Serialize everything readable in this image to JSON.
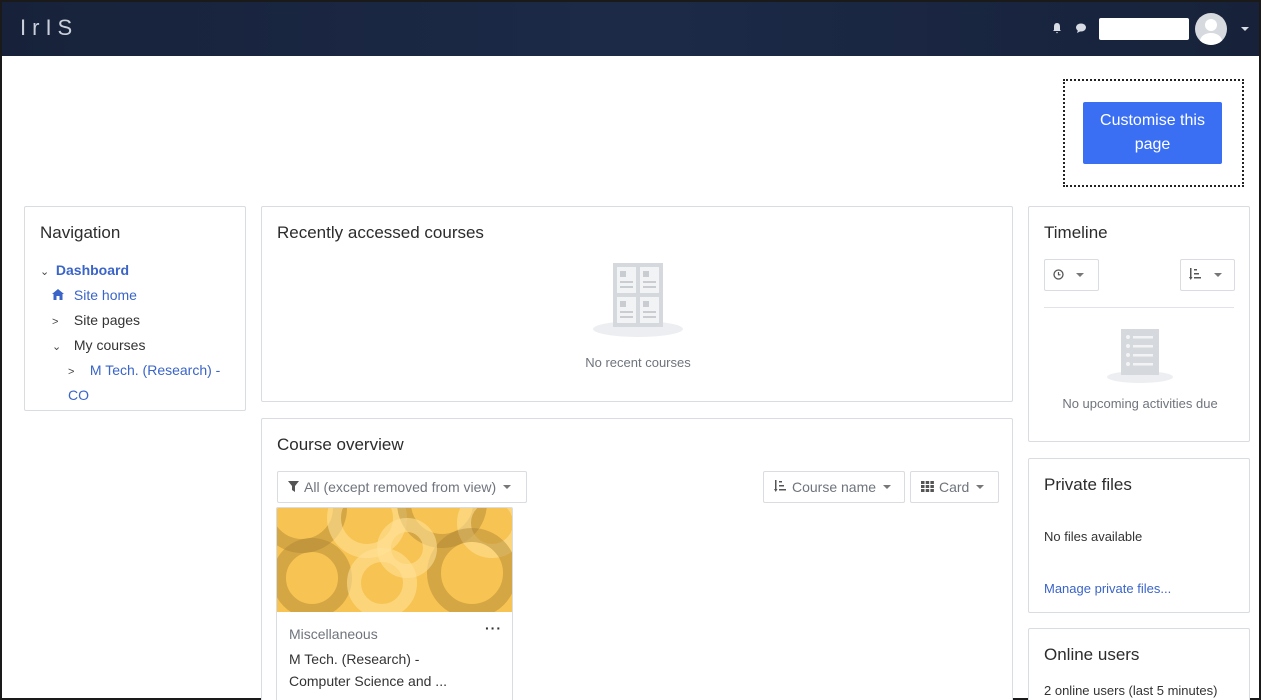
{
  "navbar": {
    "brand": "IrIS",
    "icons": [
      "bell-icon",
      "chat-icon",
      "avatar",
      "chevron-down-icon"
    ]
  },
  "customise_button": "Customise this page",
  "navigation": {
    "title": "Navigation",
    "items": [
      {
        "label": "Dashboard",
        "icon": "chevron-down-icon"
      },
      {
        "label": "Site home",
        "icon": "home-icon"
      },
      {
        "label": "Site pages",
        "icon": "chevron-right-icon"
      },
      {
        "label": "My courses",
        "icon": "chevron-down-icon"
      },
      {
        "label": "M Tech. (Research) -",
        "label2": "CO",
        "icon": "chevron-right-icon"
      }
    ]
  },
  "recent": {
    "title": "Recently accessed courses",
    "empty": "No recent courses"
  },
  "overview": {
    "title": "Course overview",
    "filter": "All (except removed from view)",
    "sort": "Course name",
    "view": "Card",
    "course": {
      "category": "Miscellaneous",
      "name_line1": "M Tech. (Research) -",
      "name_line2": "Computer Science and ..."
    }
  },
  "timeline": {
    "title": "Timeline",
    "empty": "No upcoming activities due"
  },
  "private_files": {
    "title": "Private files",
    "empty": "No files available",
    "manage": "Manage private files..."
  },
  "online_users": {
    "title": "Online users",
    "summary": "2 online users (last 5 minutes)"
  },
  "colors": {
    "navbar": "#1c2a48",
    "primary": "#3a6ff4",
    "link": "#3a64c8",
    "course_image": "#f7c453"
  }
}
